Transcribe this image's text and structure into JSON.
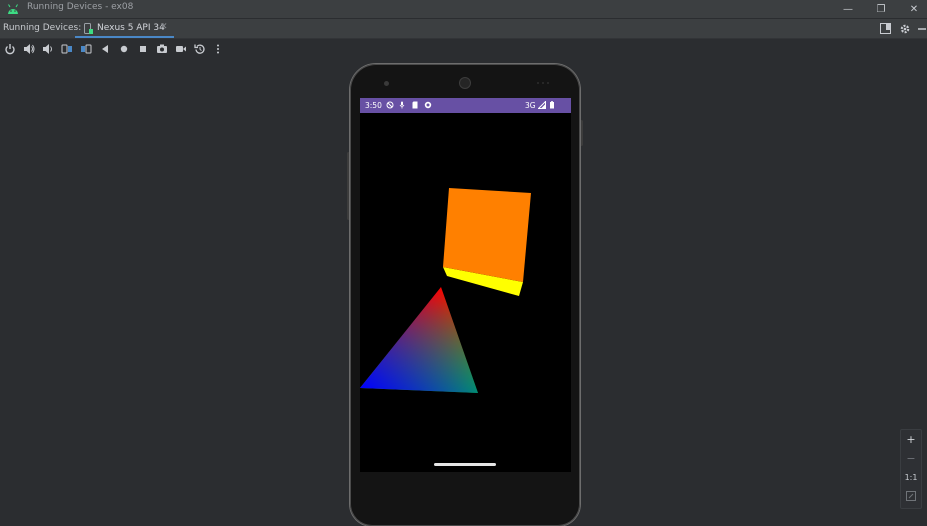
{
  "window": {
    "title": "Running Devices - ex08",
    "controls": {
      "minimize": "—",
      "restore": "❐",
      "close": "✕"
    }
  },
  "tabs": {
    "section_label": "Running Devices:",
    "active_tab": {
      "label": "Nexus 5 API 34",
      "close": "✕"
    }
  },
  "toolbar": {
    "icons": [
      "power-icon",
      "volume-up-icon",
      "volume-down-icon",
      "rotate-left-icon",
      "rotate-right-icon",
      "back-icon",
      "home-icon",
      "overview-icon",
      "screenshot-icon",
      "screen-record-icon",
      "reset-icon",
      "more-icon"
    ]
  },
  "device": {
    "status_bar": {
      "time": "3:50",
      "network": "3G"
    },
    "colors": {
      "status_bar": "#6750a4",
      "cube_front": "#ff8000",
      "cube_bottom": "#ffff00",
      "pyramid_top": "#ff0000",
      "pyramid_left": "#0000ff",
      "pyramid_right": "#00ff00"
    }
  },
  "zoom": {
    "zoom_in": "+",
    "zoom_out": "−",
    "actual_size": "1:1"
  },
  "accent": "#4a88c7"
}
